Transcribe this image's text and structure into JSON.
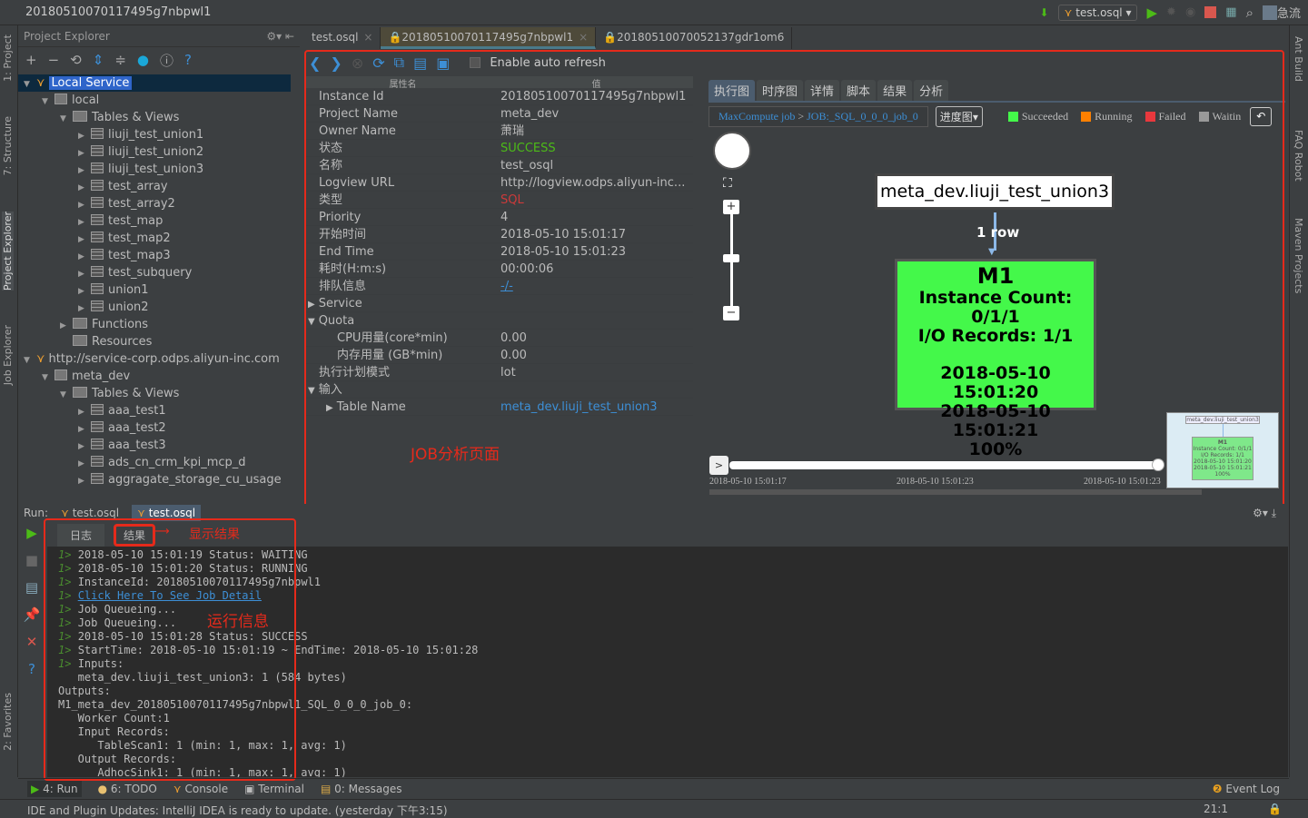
{
  "titlebar": {
    "breadcrumb": "20180510070117495g7nbpwl1",
    "run_config": "test.osql",
    "user": "急流"
  },
  "left_strip": [
    "1: Project",
    "7: Structure",
    "Project Explorer",
    "Job Explorer",
    "2: Favorites"
  ],
  "right_strip": [
    "Ant Build",
    "FAQ Robot",
    "Maven Projects"
  ],
  "project": {
    "title": "Project Explorer",
    "tree": [
      {
        "label": "Local Service",
        "level": 0,
        "arrow": "▼",
        "icon": "service",
        "selected": true
      },
      {
        "label": "local",
        "level": 1,
        "arrow": "▼",
        "icon": "project"
      },
      {
        "label": "Tables & Views",
        "level": 2,
        "arrow": "▼",
        "icon": "folder"
      },
      {
        "label": "liuji_test_union1",
        "level": 3,
        "arrow": "▶",
        "icon": "table"
      },
      {
        "label": "liuji_test_union2",
        "level": 3,
        "arrow": "▶",
        "icon": "table"
      },
      {
        "label": "liuji_test_union3",
        "level": 3,
        "arrow": "▶",
        "icon": "table"
      },
      {
        "label": "test_array",
        "level": 3,
        "arrow": "▶",
        "icon": "table"
      },
      {
        "label": "test_array2",
        "level": 3,
        "arrow": "▶",
        "icon": "table"
      },
      {
        "label": "test_map",
        "level": 3,
        "arrow": "▶",
        "icon": "table"
      },
      {
        "label": "test_map2",
        "level": 3,
        "arrow": "▶",
        "icon": "table"
      },
      {
        "label": "test_map3",
        "level": 3,
        "arrow": "▶",
        "icon": "table"
      },
      {
        "label": "test_subquery",
        "level": 3,
        "arrow": "▶",
        "icon": "table"
      },
      {
        "label": "union1",
        "level": 3,
        "arrow": "▶",
        "icon": "table"
      },
      {
        "label": "union2",
        "level": 3,
        "arrow": "▶",
        "icon": "table"
      },
      {
        "label": "Functions",
        "level": 2,
        "arrow": "▶",
        "icon": "folder"
      },
      {
        "label": "Resources",
        "level": 2,
        "arrow": "",
        "icon": "folder"
      },
      {
        "label": "http://service-corp.odps.aliyun-inc.com",
        "level": 0,
        "arrow": "▼",
        "icon": "service"
      },
      {
        "label": "meta_dev",
        "level": 1,
        "arrow": "▼",
        "icon": "project"
      },
      {
        "label": "Tables & Views",
        "level": 2,
        "arrow": "▼",
        "icon": "folder"
      },
      {
        "label": "aaa_test1",
        "level": 3,
        "arrow": "▶",
        "icon": "table"
      },
      {
        "label": "aaa_test2",
        "level": 3,
        "arrow": "▶",
        "icon": "table"
      },
      {
        "label": "aaa_test3",
        "level": 3,
        "arrow": "▶",
        "icon": "table"
      },
      {
        "label": "ads_cn_crm_kpi_mcp_d",
        "level": 3,
        "arrow": "▶",
        "icon": "table"
      },
      {
        "label": "aggragate_storage_cu_usage",
        "level": 3,
        "arrow": "▶",
        "icon": "table"
      }
    ]
  },
  "editor_tabs": [
    {
      "label": "test.osql",
      "active": false
    },
    {
      "label": "20180510070117495g7nbpwl1",
      "active": true
    },
    {
      "label": "20180510070052137gdr1om6",
      "active": false
    }
  ],
  "toolbar": {
    "auto_refresh_label": "Enable auto refresh",
    "auto_refresh_checked": false
  },
  "properties": {
    "headers": [
      "属性名",
      "值"
    ],
    "rows": [
      {
        "k": "Instance Id",
        "v": "20180510070117495g7nbpwl1"
      },
      {
        "k": "Project Name",
        "v": "meta_dev"
      },
      {
        "k": "Owner Name",
        "v": "萧瑞"
      },
      {
        "k": "状态",
        "v": "SUCCESS",
        "color": "#4cbb17"
      },
      {
        "k": "名称",
        "v": "test_osql"
      },
      {
        "k": "Logview URL",
        "v": "http://logview.odps.aliyun-inc..."
      },
      {
        "k": "类型",
        "v": "SQL",
        "color": "#cc3a3a"
      },
      {
        "k": "Priority",
        "v": "4"
      },
      {
        "k": "开始时间",
        "v": "2018-05-10 15:01:17"
      },
      {
        "k": "End Time",
        "v": "2018-05-10 15:01:23"
      },
      {
        "k": "耗时(H:m:s)",
        "v": "00:00:06"
      },
      {
        "k": "排队信息",
        "v": "-/-",
        "color": "#3d8fd6"
      },
      {
        "k": "Service",
        "v": "",
        "arrow": "▶"
      },
      {
        "k": "Quota",
        "v": "",
        "arrow": "▼"
      },
      {
        "k": "CPU用量(core*min)",
        "v": "0.00",
        "indent": true
      },
      {
        "k": "内存用量 (GB*min)",
        "v": "0.00",
        "indent": true
      },
      {
        "k": "执行计划模式",
        "v": "lot"
      },
      {
        "k": "输入",
        "v": "",
        "arrow": "▼"
      },
      {
        "k": "Table Name",
        "v": "meta_dev.liuji_test_union3",
        "arrow": "▶",
        "indent": true,
        "color": "#3d8fd6"
      }
    ]
  },
  "annotations": {
    "job_page": "JOB分析页面",
    "show_result": "显示结果",
    "run_info": "运行信息"
  },
  "graph": {
    "tabs": [
      "执行图",
      "时序图",
      "详情",
      "脚本",
      "结果",
      "分析"
    ],
    "breadcrumb": [
      "MaxCompute job",
      ">",
      "JOB:_SQL_0_0_0_job_0"
    ],
    "view_select": "进度图",
    "legend": [
      {
        "label": "Succeeded",
        "color": "#44f84a"
      },
      {
        "label": "Running",
        "color": "#ff8000"
      },
      {
        "label": "Failed",
        "color": "#e8383d"
      },
      {
        "label": "Waitin",
        "color": "#999999"
      }
    ],
    "input_node": "meta_dev.liuji_test_union3",
    "edge_label": "1 row",
    "task": {
      "name": "M1",
      "instance_count": "Instance Count: 0/1/1",
      "io_records": "I/O Records: 1/1",
      "start": "2018-05-10 15:01:20",
      "end": "2018-05-10 15:01:21",
      "progress": "100%"
    },
    "timeline": {
      "play": ">",
      "labels": [
        "2018-05-10 15:01:17",
        "2018-05-10 15:01:23",
        "2018-05-10 15:01:23"
      ],
      "position": 1.0
    },
    "minimap": {
      "table": "meta_dev.liuji_test_union3",
      "name": "M1",
      "l1": "Instance Count: 0/1/1",
      "l2": "I/O Records: 1/1",
      "l3": "2018-05-10 15:01:20",
      "l4": "2018-05-10 15:01:21",
      "l5": "100%"
    }
  },
  "run": {
    "label": "Run:",
    "tabs": [
      "test.osql",
      "test.osql"
    ],
    "subtabs": [
      "日志",
      "结果"
    ],
    "console": [
      {
        "p": "1> ",
        "t": "2018-05-10 15:01:19 Status: WAITING"
      },
      {
        "p": "1> ",
        "t": "2018-05-10 15:01:20 Status: RUNNING"
      },
      {
        "p": "1> ",
        "t": "InstanceId: 20180510070117495g7nbpwl1"
      },
      {
        "p": "1> ",
        "t": "Click Here To See Job Detail",
        "link": true
      },
      {
        "p": "1> ",
        "t": "Job Queueing..."
      },
      {
        "p": "1> ",
        "t": "Job Queueing..."
      },
      {
        "p": "1> ",
        "t": "2018-05-10 15:01:28 Status: SUCCESS"
      },
      {
        "p": "1> ",
        "t": "StartTime: 2018-05-10 15:01:19 ~ EndTime: 2018-05-10 15:01:28"
      },
      {
        "p": "1> ",
        "t": "Inputs:"
      },
      {
        "p": "",
        "t": "   meta_dev.liuji_test_union3: 1 (584 bytes)"
      },
      {
        "p": "",
        "t": "Outputs:"
      },
      {
        "p": "",
        "t": "M1_meta_dev_20180510070117495g7nbpwl1_SQL_0_0_0_job_0:"
      },
      {
        "p": "",
        "t": "   Worker Count:1"
      },
      {
        "p": "",
        "t": "   Input Records:"
      },
      {
        "p": "",
        "t": "      TableScan1: 1 (min: 1, max: 1, avg: 1)"
      },
      {
        "p": "",
        "t": "   Output Records:"
      },
      {
        "p": "",
        "t": "      AdhocSink1: 1 (min: 1, max: 1, avg: 1)"
      }
    ]
  },
  "bottom_tabs": [
    "4: Run",
    "6: TODO",
    "Console",
    "Terminal",
    "0: Messages"
  ],
  "event_log": "Event Log",
  "status": {
    "message": "IDE and Plugin Updates: IntelliJ IDEA is ready to update. (yesterday 下午3:15)",
    "position": "21:1"
  }
}
